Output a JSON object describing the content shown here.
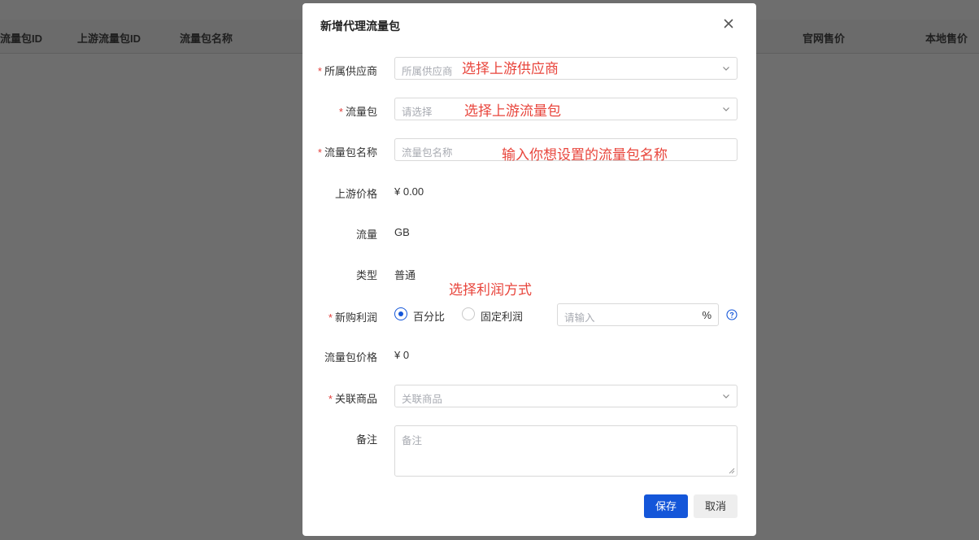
{
  "background_table": {
    "columns": [
      "流量包ID",
      "上游流量包ID",
      "流量包名称",
      "官网售价",
      "本地售价"
    ]
  },
  "dialog": {
    "title": "新增代理流量包",
    "close_icon": "close-icon",
    "fields": {
      "supplier": {
        "label": "所属供应商",
        "required": true,
        "placeholder": "所属供应商",
        "annotation": "选择上游供应商"
      },
      "package": {
        "label": "流量包",
        "required": true,
        "placeholder": "请选择",
        "annotation": "选择上游流量包"
      },
      "package_name": {
        "label": "流量包名称",
        "required": true,
        "placeholder": "流量包名称",
        "annotation": "输入你想设置的流量包名称"
      },
      "upstream_price": {
        "label": "上游价格",
        "value": "¥ 0.00"
      },
      "traffic": {
        "label": "流量",
        "value": "GB"
      },
      "type": {
        "label": "类型",
        "value": "普通",
        "annotation": "选择利润方式"
      },
      "profit": {
        "label": "新购利润",
        "required": true,
        "options": [
          "百分比",
          "固定利润"
        ],
        "selected": "百分比",
        "input_placeholder": "请输入",
        "suffix": "%"
      },
      "package_price": {
        "label": "流量包价格",
        "value": "¥ 0"
      },
      "product": {
        "label": "关联商品",
        "required": true,
        "placeholder": "关联商品"
      },
      "remark": {
        "label": "备注",
        "placeholder": "备注"
      }
    },
    "buttons": {
      "save": "保存",
      "cancel": "取消"
    },
    "colors": {
      "primary": "#1456d9",
      "required": "#e23c39",
      "annotation": "#e8453c"
    }
  }
}
